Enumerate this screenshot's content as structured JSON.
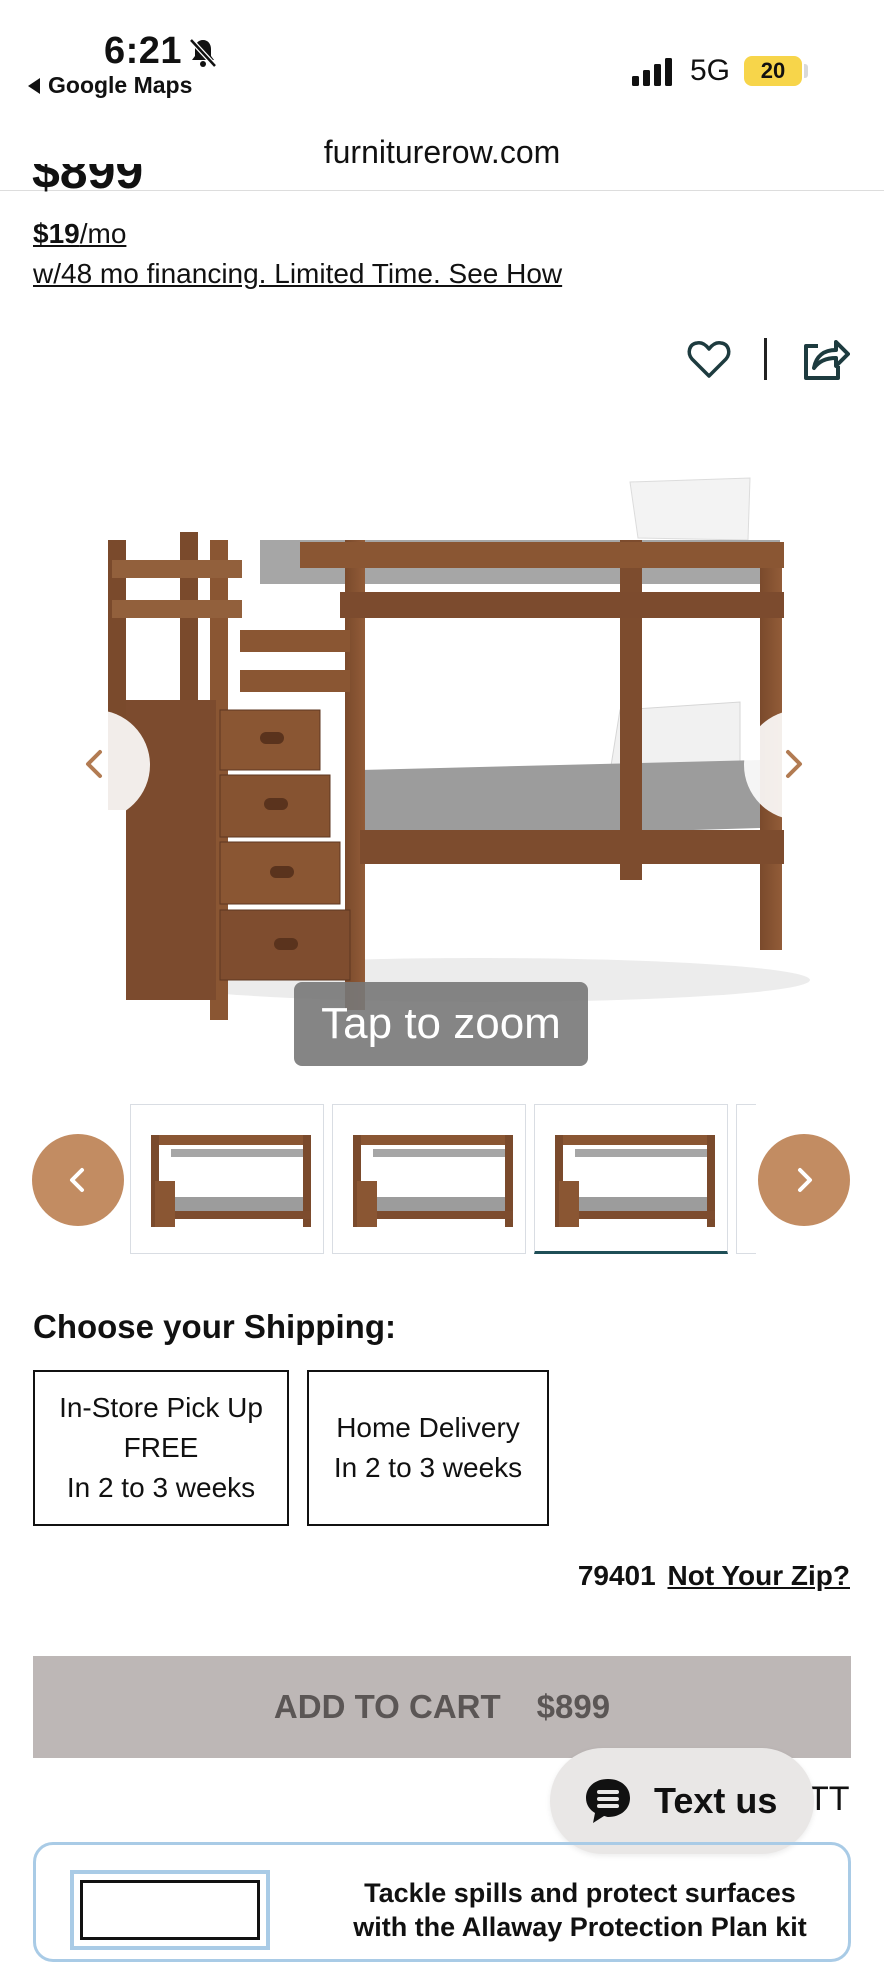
{
  "status_bar": {
    "time": "6:21",
    "back_app": "Google Maps",
    "network": "5G",
    "battery": "20"
  },
  "browser": {
    "url": "furniturerow.com"
  },
  "product": {
    "price_partial": "$899",
    "monthly_amount": "$19",
    "monthly_suffix": "/mo",
    "financing": "w/48 mo financing. Limited Time. See How",
    "tap_to_zoom": "Tap to zoom"
  },
  "shipping": {
    "title": "Choose your Shipping:",
    "options": [
      {
        "line1": "In-Store Pick Up",
        "line2": "FREE",
        "line3": "In 2 to 3 weeks"
      },
      {
        "line1": "Home Delivery",
        "line2": "In 2 to 3 weeks"
      }
    ],
    "zip": "79401",
    "zip_link": "Not Your Zip?"
  },
  "cart": {
    "label": "ADD TO CART",
    "price": "$899"
  },
  "chat": {
    "label": "Text us",
    "behind_text": "TT"
  },
  "protection": {
    "text": "Tackle spills and protect surfaces with the Allaway Protection Plan kit"
  },
  "colors": {
    "accent": "#c28c62",
    "cart_bg": "#bdb7b6",
    "selected_thumb": "#1f4f57",
    "plan_border": "#a9cbe6"
  }
}
